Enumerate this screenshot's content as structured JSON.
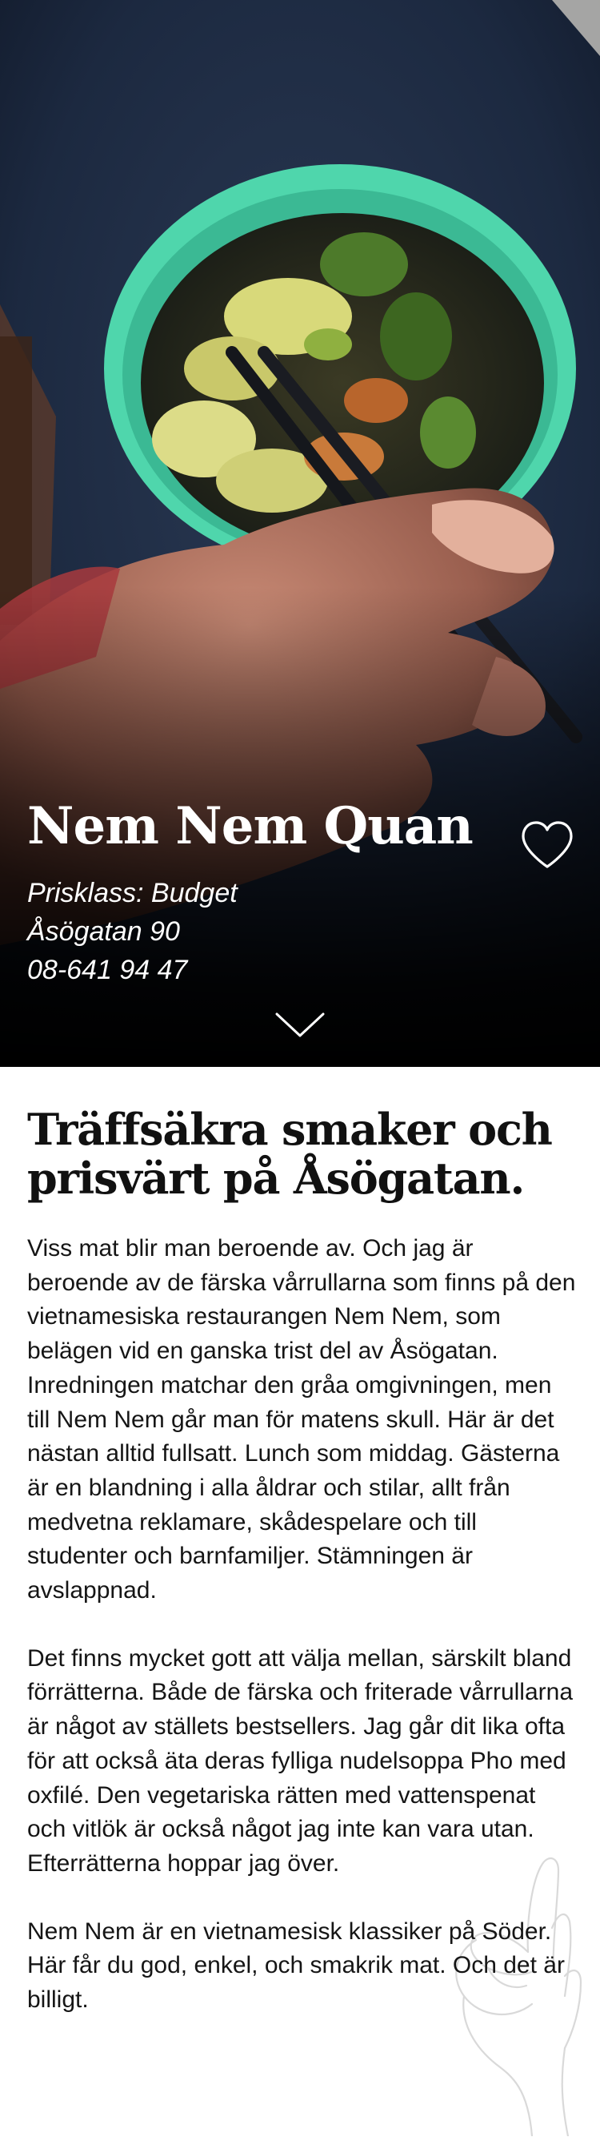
{
  "hero": {
    "name": "Nem Nem Quan",
    "price_class": "Prisklass: Budget",
    "address": "Åsögatan 90",
    "phone": "08-641 94 47",
    "favorite_icon": "heart-outline-icon",
    "scroll_icon": "chevron-down-icon"
  },
  "article": {
    "headline": "Träffsäkra smaker och prisvärt på Åsögatan.",
    "paragraphs": [
      "Viss mat blir man beroende av. Och jag är beroende av de färska vårrullarna som finns på den vietnamesiska restaurangen Nem Nem, som belägen vid en ganska trist del av Åsögatan. Inredningen matchar den gråa omgivningen, men till Nem Nem går man för matens skull. Här är det nästan alltid fullsatt. Lunch som middag. Gästerna är en blandning i alla åldrar och stilar, allt från medvetna reklamare, skådespelare och till studenter och barnfamiljer. Stämningen är avslappnad.",
      "Det finns mycket gott att välja mellan, särskilt bland förrätterna. Både de färska och friterade vårrullarna är något av ställets bestsellers. Jag går dit lika ofta för att också äta deras fylliga nudelsoppa Pho med oxfilé. Den vegetariska rätten med vattenspenat och vitlök är också något jag inte kan vara utan. Efterrätterna hoppar jag över.",
      "Nem Nem är en vietnamesisk klassiker på Söder. Här får du god, enkel, och smakrik mat. Och det är billigt."
    ],
    "decoration_icon": "ok-hand-icon"
  },
  "colors": {
    "hero_background": "#1b2538",
    "bowl": "#4fd6ac",
    "text": "#151515",
    "on_dark": "#ffffff"
  }
}
